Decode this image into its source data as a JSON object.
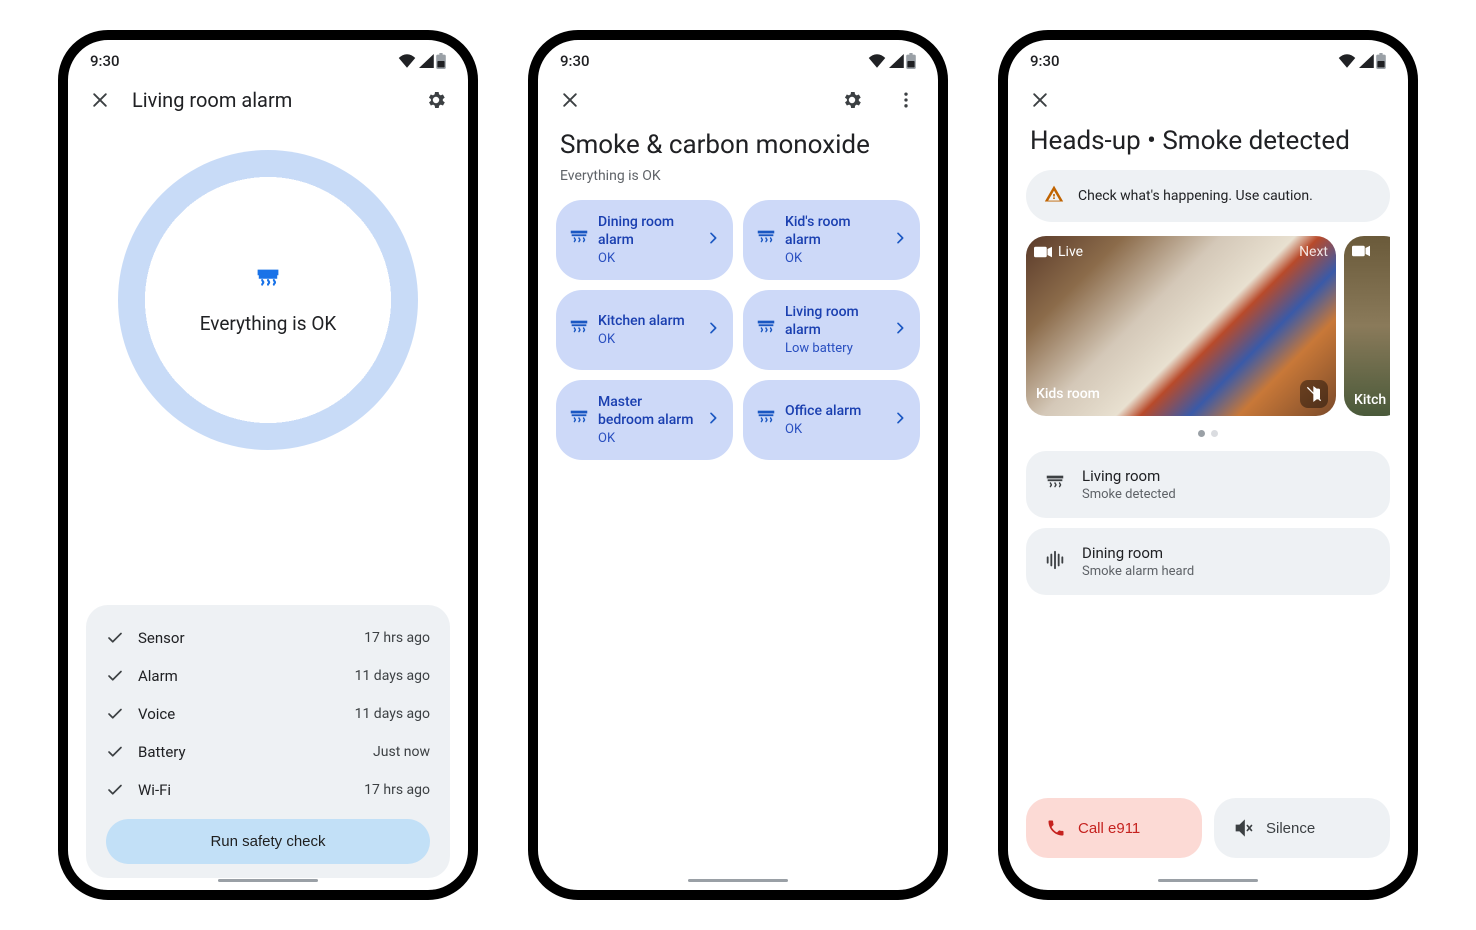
{
  "status_time": "9:30",
  "screen1": {
    "title": "Living room alarm",
    "status_label": "Everything is OK",
    "checks": [
      {
        "label": "Sensor",
        "time": "17 hrs ago"
      },
      {
        "label": "Alarm",
        "time": "11 days ago"
      },
      {
        "label": "Voice",
        "time": "11 days ago"
      },
      {
        "label": "Battery",
        "time": "Just now"
      },
      {
        "label": "Wi-Fi",
        "time": "17 hrs ago"
      }
    ],
    "run_label": "Run safety check"
  },
  "screen2": {
    "title": "Smoke & carbon monoxide",
    "subtitle": "Everything is OK",
    "tiles": [
      {
        "label": "Dining room alarm",
        "status": "OK"
      },
      {
        "label": "Kid's room alarm",
        "status": "OK"
      },
      {
        "label": "Kitchen alarm",
        "status": "OK"
      },
      {
        "label": "Living room alarm",
        "status": "Low battery"
      },
      {
        "label": "Master bedroom alarm",
        "status": "OK"
      },
      {
        "label": "Office alarm",
        "status": "OK"
      }
    ]
  },
  "screen3": {
    "title": "Heads-up • Smoke detected",
    "warn_text": "Check what's happening. Use caution.",
    "cameras": [
      {
        "live_label": "Live",
        "next_label": "Next",
        "room": "Kids room"
      },
      {
        "room": "Kitch"
      }
    ],
    "alerts": [
      {
        "room": "Living room",
        "detail": "Smoke detected",
        "icon": "detector"
      },
      {
        "room": "Dining room",
        "detail": "Smoke alarm heard",
        "icon": "sound"
      }
    ],
    "call_label": "Call e911",
    "silence_label": "Silence"
  }
}
